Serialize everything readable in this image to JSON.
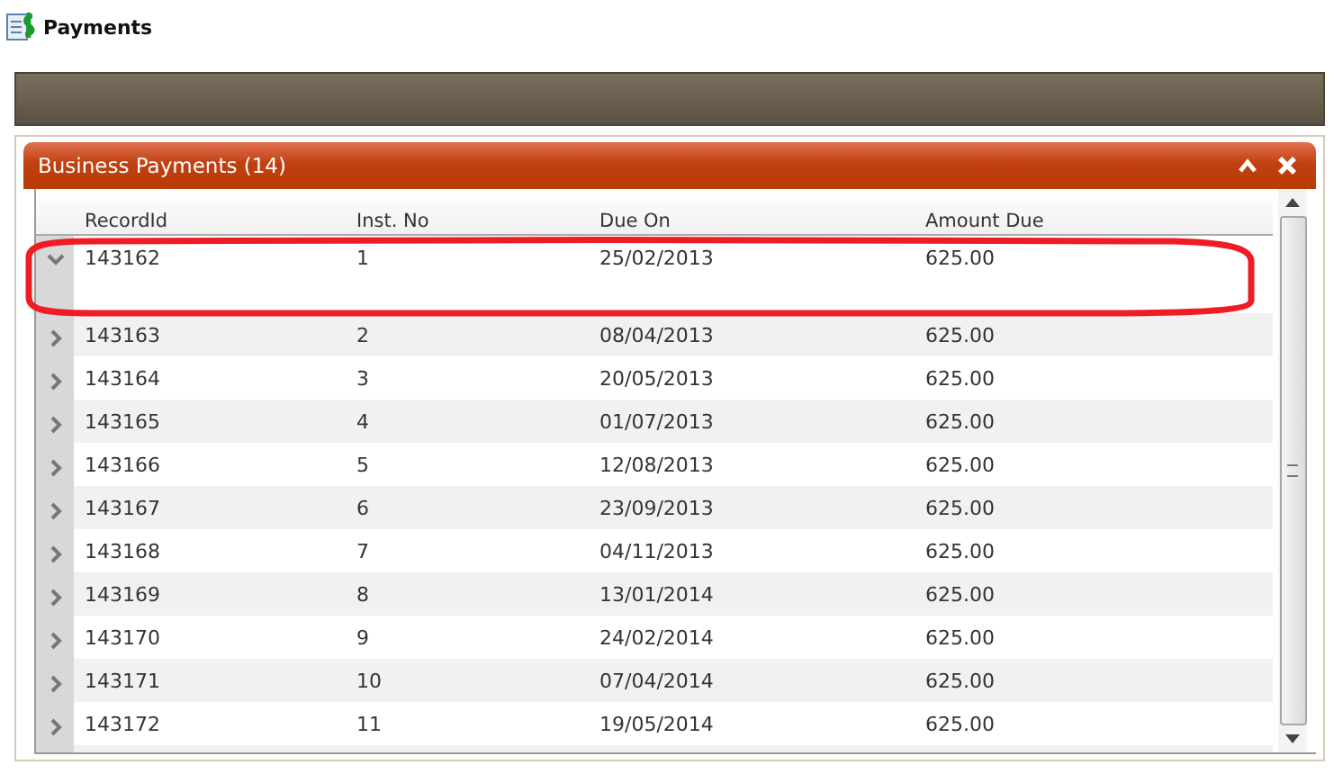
{
  "page": {
    "title": "Payments"
  },
  "panel": {
    "title": "Business Payments (14)"
  },
  "table": {
    "columns": [
      "RecordId",
      "Inst. No",
      "Due On",
      "Amount Due"
    ],
    "rows": [
      {
        "expanded": true,
        "cells": [
          "143162",
          "1",
          "25/02/2013",
          "625.00"
        ]
      },
      {
        "expanded": false,
        "cells": [
          "143163",
          "2",
          "08/04/2013",
          "625.00"
        ]
      },
      {
        "expanded": false,
        "cells": [
          "143164",
          "3",
          "20/05/2013",
          "625.00"
        ]
      },
      {
        "expanded": false,
        "cells": [
          "143165",
          "4",
          "01/07/2013",
          "625.00"
        ]
      },
      {
        "expanded": false,
        "cells": [
          "143166",
          "5",
          "12/08/2013",
          "625.00"
        ]
      },
      {
        "expanded": false,
        "cells": [
          "143167",
          "6",
          "23/09/2013",
          "625.00"
        ]
      },
      {
        "expanded": false,
        "cells": [
          "143168",
          "7",
          "04/11/2013",
          "625.00"
        ]
      },
      {
        "expanded": false,
        "cells": [
          "143169",
          "8",
          "13/01/2014",
          "625.00"
        ]
      },
      {
        "expanded": false,
        "cells": [
          "143170",
          "9",
          "24/02/2014",
          "625.00"
        ]
      },
      {
        "expanded": false,
        "cells": [
          "143171",
          "10",
          "07/04/2014",
          "625.00"
        ]
      },
      {
        "expanded": false,
        "cells": [
          "143172",
          "11",
          "19/05/2014",
          "625.00"
        ]
      }
    ]
  }
}
